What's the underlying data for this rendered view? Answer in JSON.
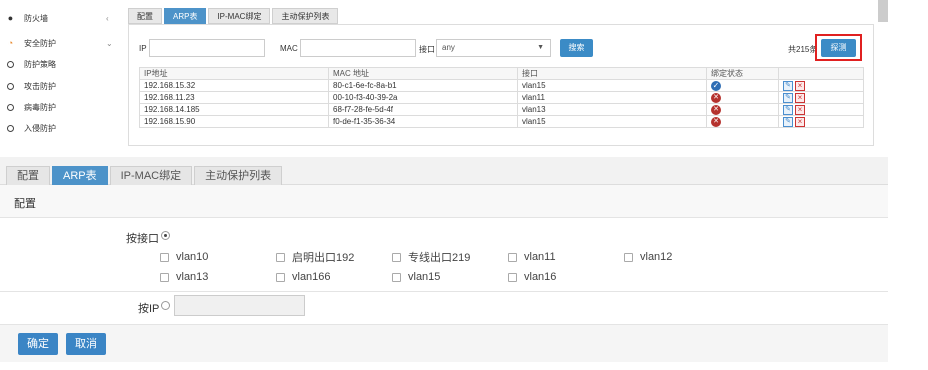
{
  "top": {
    "sidebar": {
      "items": [
        {
          "label": "防火墙",
          "icon": "firewall-icon",
          "chevron": "‹"
        },
        {
          "label": "安全防护",
          "icon": "shield-icon",
          "chevron": "⌄"
        },
        {
          "label": "防护策略",
          "icon": "circle-icon"
        },
        {
          "label": "攻击防护",
          "icon": "circle-icon"
        },
        {
          "label": "病毒防护",
          "icon": "circle-icon"
        },
        {
          "label": "入侵防护",
          "icon": "circle-icon"
        }
      ]
    },
    "tabs": [
      {
        "label": "配置",
        "active": false
      },
      {
        "label": "ARP表",
        "active": true
      },
      {
        "label": "IP-MAC绑定",
        "active": false
      },
      {
        "label": "主动保护列表",
        "active": false
      }
    ],
    "filters": {
      "ip_label": "IP",
      "mac_label": "MAC",
      "interface_label": "接口",
      "interface_value": "any",
      "search_button": "搜索",
      "total_text": "共215条",
      "probe_button": "探测"
    },
    "table": {
      "columns": [
        "IP地址",
        "MAC 地址",
        "接口",
        "绑定状态",
        ""
      ],
      "rows": [
        {
          "ip": "192.168.15.32",
          "mac": "80-c1-6e-fc-8a-b1",
          "iface": "vlan15",
          "status": "bound"
        },
        {
          "ip": "192.168.11.23",
          "mac": "00-10-f3-40-39-2a",
          "iface": "vlan11",
          "status": "unbound"
        },
        {
          "ip": "192.168.14.185",
          "mac": "68-f7-28-fe-5d-4f",
          "iface": "vlan13",
          "status": "unbound"
        },
        {
          "ip": "192.168.15.90",
          "mac": "f0-de-f1-35-36-34",
          "iface": "vlan15",
          "status": "unbound"
        }
      ]
    }
  },
  "bottom": {
    "tabs": [
      {
        "label": "配置",
        "active": false
      },
      {
        "label": "ARP表",
        "active": true
      },
      {
        "label": "IP-MAC绑定",
        "active": false
      },
      {
        "label": "主动保护列表",
        "active": false
      }
    ],
    "section_title": "配置",
    "by_interface_label": "按接口",
    "interfaces": [
      "vlan10",
      "启明出口192",
      "专线出口219",
      "vlan11",
      "vlan12",
      "vlan13",
      "vlan166",
      "vlan15",
      "vlan16"
    ],
    "by_ip_label": "按IP",
    "confirm_button": "确定",
    "cancel_button": "取消"
  },
  "colors": {
    "accent": "#4d93c9",
    "button_blue": "#3b85c5",
    "highlight_red": "#e02020",
    "status_bound": "#2e6db4",
    "status_unbound": "#b5322e"
  }
}
